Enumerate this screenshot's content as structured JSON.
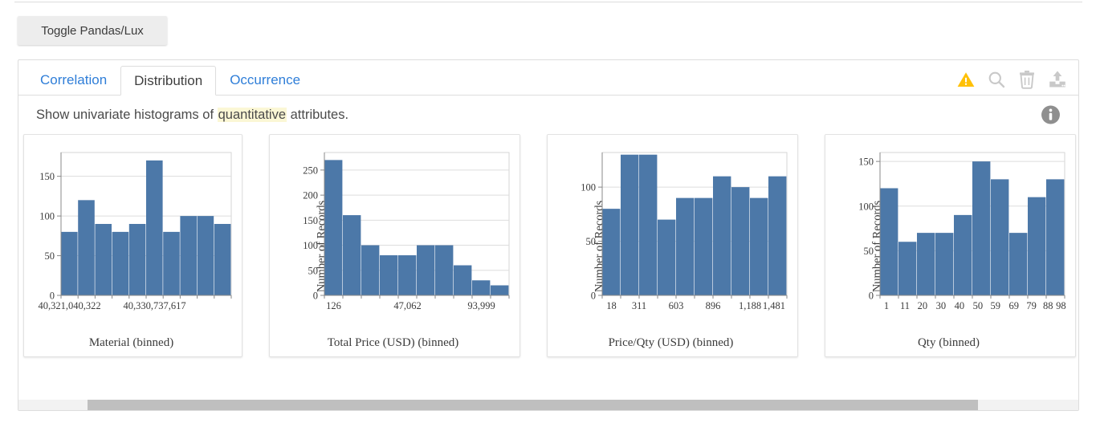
{
  "toolbar": {
    "toggle_label": "Toggle Pandas/Lux"
  },
  "tabs": [
    {
      "label": "Correlation",
      "active": false
    },
    {
      "label": "Distribution",
      "active": true
    },
    {
      "label": "Occurrence",
      "active": false
    }
  ],
  "tab_icons": [
    {
      "name": "warning-icon",
      "color": "#FFC107"
    },
    {
      "name": "search-icon",
      "color": "#c9c9c9"
    },
    {
      "name": "trash-icon",
      "color": "#c9c9c9"
    },
    {
      "name": "upload-icon",
      "color": "#c9c9c9"
    }
  ],
  "description": {
    "prefix": "Show univariate histograms of ",
    "highlight": "quantitative",
    "suffix": " attributes.",
    "highlight_color": "#fbf7d5",
    "info_icon": "info-icon"
  },
  "colors": {
    "bar": "#4c78a8",
    "axis": "#888888",
    "grid": "#dddddd",
    "tab_link": "#2f7ed8",
    "tab_active_text": "#3f3f3f"
  },
  "scrollbar": {
    "thumb_left_pct": 6.5,
    "thumb_width_pct": 84
  },
  "chart_data": [
    {
      "type": "bar",
      "title": "",
      "xlabel": "Material (binned)",
      "ylabel": "",
      "values": [
        80,
        120,
        90,
        80,
        90,
        170,
        80,
        100,
        100,
        90
      ],
      "ylim": [
        0,
        180
      ],
      "yticks": [
        0,
        50,
        100,
        150
      ],
      "ytick_labels": [
        "0",
        "50",
        "100",
        "150"
      ],
      "xtick_positions": [
        0.5,
        5.5
      ],
      "xtick_labels": [
        "40,321,040,322",
        "40,330,737,617"
      ],
      "grid": true,
      "legend": "none"
    },
    {
      "type": "bar",
      "title": "",
      "xlabel": "Total Price (USD) (binned)",
      "ylabel": "Number of Records",
      "values": [
        270,
        160,
        100,
        80,
        80,
        100,
        100,
        60,
        30,
        20
      ],
      "ylim": [
        0,
        285
      ],
      "yticks": [
        0,
        50,
        100,
        150,
        200,
        250
      ],
      "ytick_labels": [
        "0",
        "50",
        "100",
        "150",
        "200",
        "250"
      ],
      "xtick_positions": [
        0.5,
        4.5,
        8.5
      ],
      "xtick_labels": [
        "126",
        "47,062",
        "93,999"
      ],
      "grid": true,
      "legend": "none"
    },
    {
      "type": "bar",
      "title": "",
      "xlabel": "Price/Qty (USD) (binned)",
      "ylabel": "Number of Records",
      "values": [
        80,
        130,
        130,
        70,
        90,
        90,
        110,
        100,
        90,
        110
      ],
      "ylim": [
        0,
        132
      ],
      "yticks": [
        0,
        50,
        100
      ],
      "ytick_labels": [
        "0",
        "50",
        "100"
      ],
      "xtick_positions": [
        0.5,
        2.0,
        4.0,
        6.0,
        8.0,
        9.3
      ],
      "xtick_labels": [
        "18",
        "311",
        "603",
        "896",
        "1,188",
        "1,481"
      ],
      "grid": true,
      "legend": "none"
    },
    {
      "type": "bar",
      "title": "",
      "xlabel": "Qty (binned)",
      "ylabel": "Number of Records",
      "values": [
        120,
        60,
        70,
        70,
        90,
        150,
        130,
        70,
        110,
        130
      ],
      "ylim": [
        0,
        160
      ],
      "yticks": [
        0,
        50,
        100,
        150
      ],
      "ytick_labels": [
        "0",
        "50",
        "100",
        "150"
      ],
      "xtick_positions": [
        0.35,
        1.35,
        2.3,
        3.3,
        4.3,
        5.3,
        6.25,
        7.25,
        8.2,
        9.1,
        9.8
      ],
      "xtick_labels": [
        "1",
        "11",
        "20",
        "30",
        "40",
        "50",
        "59",
        "69",
        "79",
        "88",
        "98"
      ],
      "grid": true,
      "legend": "none"
    }
  ]
}
